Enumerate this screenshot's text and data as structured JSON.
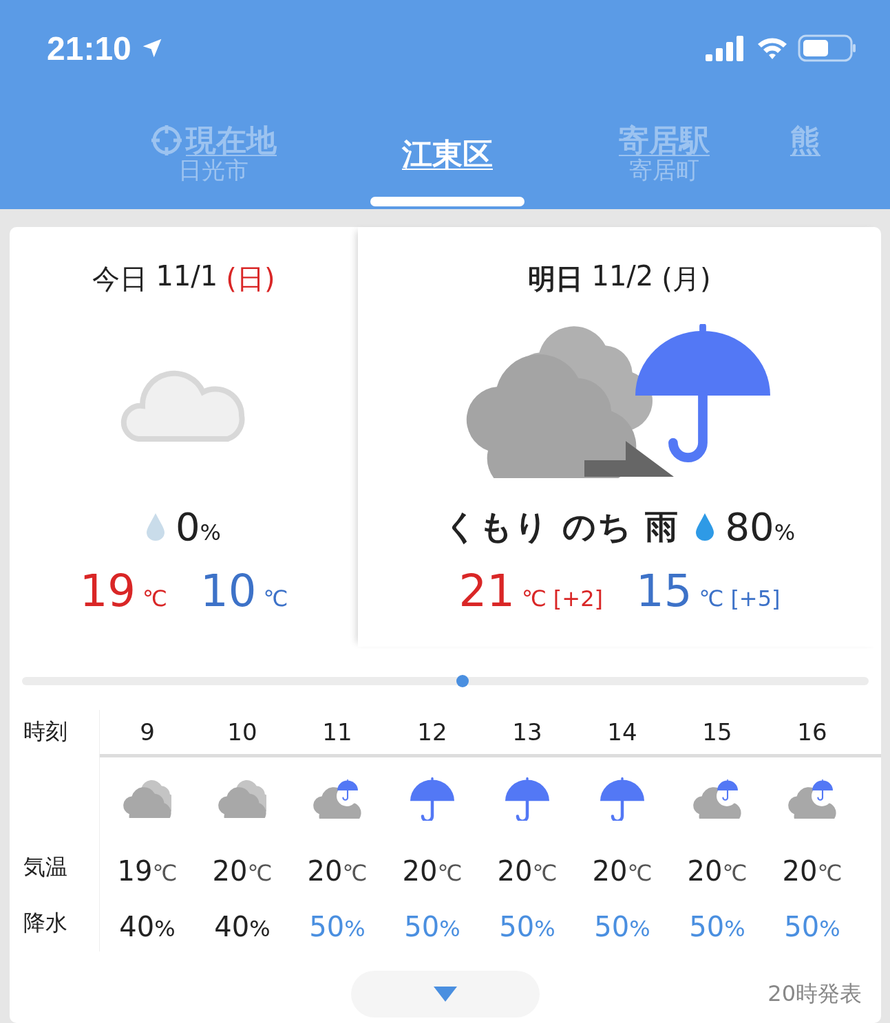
{
  "status_bar": {
    "time": "21:10"
  },
  "tabs": [
    {
      "title": "現在地",
      "subtitle": "日光市",
      "kind": "current",
      "selected": false
    },
    {
      "title": "江東区",
      "kind": "place",
      "selected": true
    },
    {
      "title": "寄居駅",
      "subtitle": "寄居町",
      "kind": "place",
      "selected": false
    },
    {
      "title": "熊",
      "kind": "place",
      "selected": false
    }
  ],
  "days": [
    {
      "label": "今日",
      "date": "11/1",
      "weekday": "(日)",
      "holiday": true,
      "selected": false,
      "kind": "cloudy",
      "rain": "0",
      "rain_unit": "%",
      "high": "19",
      "high_unit": "℃",
      "low": "10",
      "low_unit": "℃"
    },
    {
      "label": "明日",
      "date": "11/2",
      "weekday": "(月)",
      "holiday": false,
      "selected": true,
      "kind": "cloudy-then-rain",
      "weather": "くもり のち 雨",
      "rain": "80",
      "rain_unit": "%",
      "high": "21",
      "high_unit": "℃",
      "high_diff": "[+2]",
      "low": "15",
      "low_unit": "℃",
      "low_diff": "[+5]"
    }
  ],
  "pager": {
    "level": 0.52
  },
  "hourly": {
    "row_labels": [
      "時刻",
      "気温",
      "降水"
    ],
    "hours": [
      {
        "time": "9",
        "kind": "cloudy",
        "temp": "19",
        "unit": "℃",
        "rain": "40",
        "rain_unit": "%",
        "wet": false
      },
      {
        "time": "10",
        "kind": "cloudy",
        "temp": "20",
        "unit": "℃",
        "rain": "40",
        "rain_unit": "%",
        "wet": false
      },
      {
        "time": "11",
        "kind": "cloud-rain",
        "temp": "20",
        "unit": "℃",
        "rain": "50",
        "rain_unit": "%",
        "wet": true
      },
      {
        "time": "12",
        "kind": "rain",
        "temp": "20",
        "unit": "℃",
        "rain": "50",
        "rain_unit": "%",
        "wet": true
      },
      {
        "time": "13",
        "kind": "rain",
        "temp": "20",
        "unit": "℃",
        "rain": "50",
        "rain_unit": "%",
        "wet": true
      },
      {
        "time": "14",
        "kind": "rain",
        "temp": "20",
        "unit": "℃",
        "rain": "50",
        "rain_unit": "%",
        "wet": true
      },
      {
        "time": "15",
        "kind": "cloud-rain",
        "temp": "20",
        "unit": "℃",
        "rain": "50",
        "rain_unit": "%",
        "wet": true
      },
      {
        "time": "16",
        "kind": "cloud-rain",
        "temp": "20",
        "unit": "℃",
        "rain": "50",
        "rain_unit": "%",
        "wet": true
      }
    ]
  },
  "footer": {
    "issued": "20時発表"
  }
}
